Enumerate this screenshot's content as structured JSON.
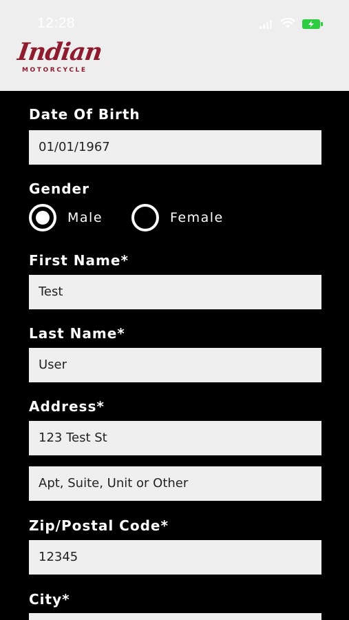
{
  "status_bar": {
    "time": "12:28",
    "icons": [
      "signal-icon",
      "wifi-icon",
      "battery-charging-icon"
    ],
    "battery_color": "#2ecc40"
  },
  "header": {
    "logo_text": "Indian",
    "logo_subtext": "MOTORCYCLE",
    "logo_color": "#8e1b2e"
  },
  "form": {
    "dob": {
      "label": "Date Of Birth",
      "value": "01/01/1967"
    },
    "gender": {
      "label": "Gender",
      "options": [
        {
          "label": "Male",
          "selected": true
        },
        {
          "label": "Female",
          "selected": false
        }
      ]
    },
    "first_name": {
      "label": "First Name*",
      "value": "Test"
    },
    "last_name": {
      "label": "Last Name*",
      "value": "User"
    },
    "address": {
      "label": "Address*",
      "line1": "123 Test St",
      "line2_placeholder": "Apt, Suite, Unit or Other"
    },
    "zip": {
      "label": "Zip/Postal Code*",
      "value": "12345"
    },
    "city": {
      "label": "City*",
      "value": ""
    }
  }
}
